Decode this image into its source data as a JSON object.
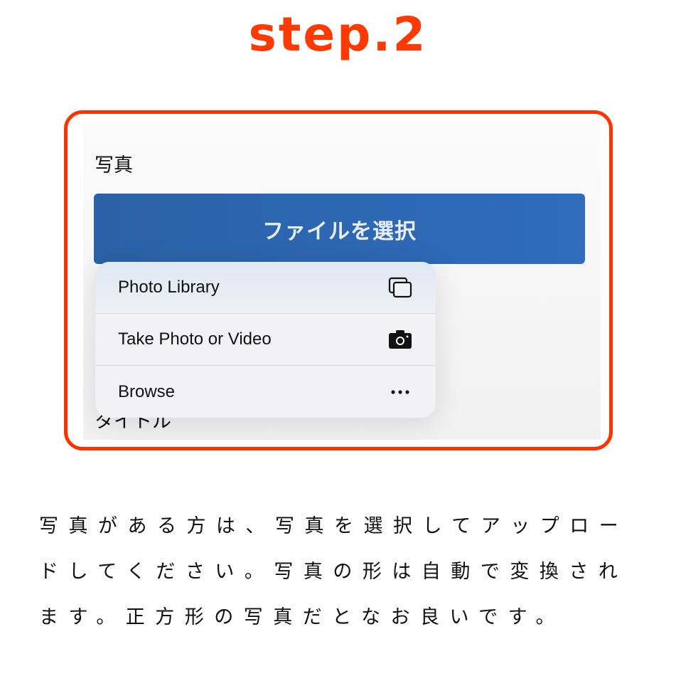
{
  "header": {
    "title": "step.2"
  },
  "screenshot": {
    "field_label": "写真",
    "file_button_label": "ファイルを選択",
    "next_field_label_partial": "タイトル",
    "menu": {
      "items": [
        {
          "label": "Photo Library",
          "icon": "photo-library-icon"
        },
        {
          "label": "Take Photo or Video",
          "icon": "camera-icon"
        },
        {
          "label": "Browse",
          "icon": "more-icon"
        }
      ]
    }
  },
  "description": {
    "lines": [
      "写真がある方は、写真を選択してアップロー",
      "ドしてください。写真の形は自動で変換され",
      "ます。正方形の写真だとなお良いです。"
    ]
  },
  "colors": {
    "accent": "#ff3300",
    "button": "#2d67b0"
  }
}
